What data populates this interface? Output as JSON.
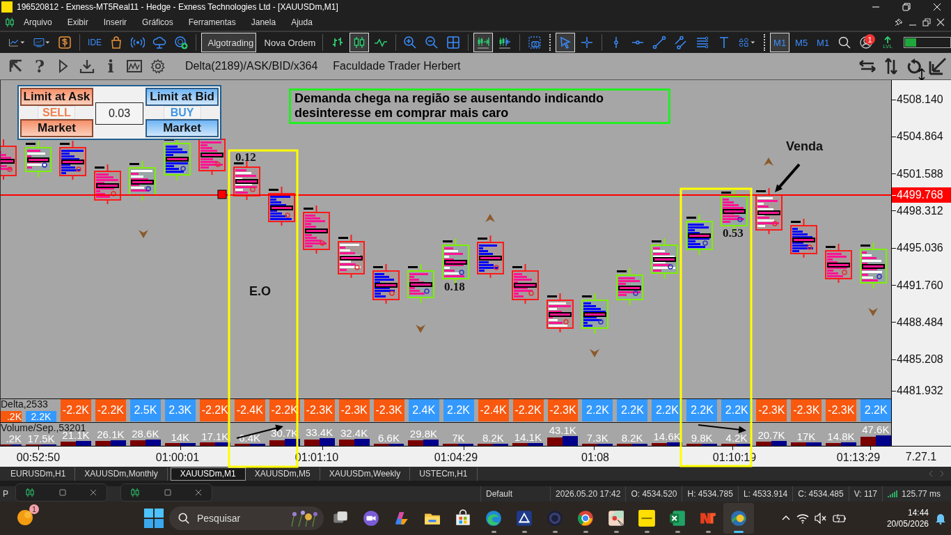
{
  "window": {
    "title": "196520812 - Exness-MT5Real11 - Hedge - Exness Technologies Ltd - [XAUUSDm,M1]"
  },
  "menu": [
    "Arquivo",
    "Exibir",
    "Inserir",
    "Gráficos",
    "Ferramentas",
    "Janela",
    "Ajuda"
  ],
  "toolbar": {
    "items": [
      {
        "kind": "icon",
        "selected": false
      },
      {
        "kind": "icon",
        "selected": false
      },
      {
        "kind": "icon",
        "selected": false
      },
      {
        "kind": "separator"
      },
      {
        "kind": "text",
        "label": "IDE",
        "selected": false
      },
      {
        "kind": "icon",
        "selected": false
      },
      {
        "kind": "icon",
        "selected": false
      },
      {
        "kind": "icon",
        "selected": false
      },
      {
        "kind": "icon",
        "selected": false
      },
      {
        "kind": "separator"
      },
      {
        "kind": "button",
        "label": "Algotrading",
        "selected": true
      },
      {
        "kind": "button",
        "label": "Nova Ordem",
        "selected": false
      },
      {
        "kind": "separator"
      },
      {
        "kind": "icon",
        "selected": false
      },
      {
        "kind": "icon",
        "selected": true
      },
      {
        "kind": "icon",
        "selected": false
      },
      {
        "kind": "separator"
      },
      {
        "kind": "icon",
        "selected": false
      },
      {
        "kind": "icon",
        "selected": false
      },
      {
        "kind": "icon",
        "selected": false
      },
      {
        "kind": "separator"
      },
      {
        "kind": "icon",
        "selected": true
      },
      {
        "kind": "icon",
        "selected": false
      },
      {
        "kind": "separator"
      },
      {
        "kind": "icon",
        "selected": false
      },
      {
        "kind": "dotted_separator"
      },
      {
        "kind": "icon",
        "selected": true
      },
      {
        "kind": "icon",
        "selected": false
      },
      {
        "kind": "separator"
      },
      {
        "kind": "icon",
        "selected": false
      },
      {
        "kind": "icon",
        "selected": false
      },
      {
        "kind": "icon",
        "selected": false
      },
      {
        "kind": "icon",
        "selected": false
      },
      {
        "kind": "icon",
        "selected": false
      },
      {
        "kind": "icon",
        "selected": false
      },
      {
        "kind": "icon",
        "selected": false
      },
      {
        "kind": "dotted_separator"
      },
      {
        "kind": "timeframe",
        "label": "M1",
        "selected": true
      },
      {
        "kind": "timeframe",
        "label": "M5",
        "selected": false
      },
      {
        "kind": "timeframe",
        "label": "M1",
        "selected": false
      },
      {
        "kind": "icon",
        "selected": false
      },
      {
        "kind": "account",
        "badge": "1"
      },
      {
        "kind": "lvl",
        "label": "LVL"
      },
      {
        "kind": "meter",
        "level": 0.25
      }
    ]
  },
  "chart_tools": [
    {
      "kind": "icon"
    },
    {
      "kind": "glyph",
      "text": "?"
    },
    {
      "kind": "icon"
    },
    {
      "kind": "icon"
    },
    {
      "kind": "glyph",
      "text": "i"
    },
    {
      "kind": "icon"
    },
    {
      "kind": "icon"
    }
  ],
  "indicator": "Delta(2189)/ASK/BID/x364",
  "author": "Faculdade Trader Herbert",
  "order_panel": {
    "sell_limit": "Limit at Ask",
    "sell": "SELL",
    "sell_market": "Market",
    "volume": "0.03",
    "buy_limit": "Limit at Bid",
    "buy": "BUY",
    "buy_market": "Market"
  },
  "note": "Demanda chega na região se ausentando indicando desinteresse em comprar mais caro",
  "labels": [
    {
      "kind": "value",
      "text": "0.12"
    },
    {
      "kind": "value",
      "text": "0.18"
    },
    {
      "kind": "value",
      "text": "0.53"
    },
    {
      "kind": "caption",
      "text": "E.O"
    },
    {
      "kind": "caption",
      "text": "Venda"
    }
  ],
  "footprint": {
    "candles": [
      {
        "kind": "bear"
      },
      {
        "kind": "bull"
      },
      {
        "kind": "bear"
      },
      {
        "kind": "bear"
      },
      {
        "kind": "bull"
      },
      {
        "kind": "bull"
      },
      {
        "kind": "bear"
      },
      {
        "kind": "bear"
      },
      {
        "kind": "bear"
      },
      {
        "kind": "bear"
      },
      {
        "kind": "bear"
      },
      {
        "kind": "bear"
      },
      {
        "kind": "bull"
      },
      {
        "kind": "bull"
      },
      {
        "kind": "bear"
      },
      {
        "kind": "bear"
      },
      {
        "kind": "bear"
      },
      {
        "kind": "bull"
      },
      {
        "kind": "bull"
      },
      {
        "kind": "bull"
      },
      {
        "kind": "bull"
      },
      {
        "kind": "bull"
      },
      {
        "kind": "bear"
      },
      {
        "kind": "bear"
      },
      {
        "kind": "bear"
      },
      {
        "kind": "bull"
      }
    ]
  },
  "price_axis": {
    "ticks": [
      "4508.140",
      "4504.864",
      "4501.588",
      "4498.312",
      "4495.036",
      "4491.760",
      "4488.484",
      "4485.208",
      "4481.932"
    ],
    "current": "4499.768"
  },
  "delta": {
    "title": "Delta,2533",
    "bars": [
      {
        "value": ".2K",
        "color": "#f9580f"
      },
      {
        "value": "2.2K",
        "color": "#3399ff"
      },
      {
        "value": "-2.2K",
        "color": "#f9580f"
      },
      {
        "value": "-2.2K",
        "color": "#f9580f"
      },
      {
        "value": "2.5K",
        "color": "#3399ff"
      },
      {
        "value": "2.3K",
        "color": "#3399ff"
      },
      {
        "value": "-2.2K",
        "color": "#f9580f"
      },
      {
        "value": "-2.4K",
        "color": "#f9580f"
      },
      {
        "value": "-2.2K",
        "color": "#f9580f"
      },
      {
        "value": "-2.3K",
        "color": "#f9580f"
      },
      {
        "value": "-2.3K",
        "color": "#f9580f"
      },
      {
        "value": "-2.3K",
        "color": "#f9580f"
      },
      {
        "value": "2.4K",
        "color": "#3399ff"
      },
      {
        "value": "2.2K",
        "color": "#3399ff"
      },
      {
        "value": "-2.4K",
        "color": "#f9580f"
      },
      {
        "value": "-2.2K",
        "color": "#f9580f"
      },
      {
        "value": "-2.3K",
        "color": "#f9580f"
      },
      {
        "value": "2.2K",
        "color": "#3399ff"
      },
      {
        "value": "2.2K",
        "color": "#3399ff"
      },
      {
        "value": "2.2K",
        "color": "#3399ff"
      },
      {
        "value": "2.2K",
        "color": "#3399ff"
      },
      {
        "value": "2.2K",
        "color": "#3399ff"
      },
      {
        "value": "-2.3K",
        "color": "#f9580f"
      },
      {
        "value": "-2.3K",
        "color": "#f9580f"
      },
      {
        "value": "-2.3K",
        "color": "#f9580f"
      },
      {
        "value": "2.2K",
        "color": "#3399ff"
      }
    ]
  },
  "volume": {
    "title": "Volume/Sep.,53201",
    "bars": [
      ".2K",
      "17.5K",
      "21.1K",
      "26.1K",
      "28.6K",
      "14K",
      "17.1K",
      "6.4K",
      "30.7K",
      "33.4K",
      "32.4K",
      "6.6K",
      "29.8K",
      "7K",
      "8.2K",
      "14.1K",
      "43.1K",
      "7.3K",
      "8.2K",
      "14.6K",
      "9.8K",
      "4.2K",
      "20.7K",
      "17K",
      "14.8K",
      "47.6K"
    ]
  },
  "time_axis": [
    "00:52:50",
    "01:00:01",
    "01:01:10",
    "01:04:29",
    "01:08",
    "01:10:19",
    "01:13:29"
  ],
  "version": "7.27.1",
  "tabs": [
    {
      "label": "EURUSDm,H1",
      "selected": false
    },
    {
      "label": "XAUUSDm,Monthly",
      "selected": false
    },
    {
      "label": "XAUUSDm,M1",
      "selected": true
    },
    {
      "label": "XAUUSDm,M5",
      "selected": false
    },
    {
      "label": "XAUUSDm,Weekly",
      "selected": false
    },
    {
      "label": "USTECm,H1",
      "selected": false
    }
  ],
  "minimized_windows": [
    {
      "kind": "chart"
    },
    {
      "kind": "chart"
    }
  ],
  "status_bar": {
    "left": "P",
    "profile": "Default",
    "datetime": "2026.05.20 17:42",
    "open": "O: 4534.520",
    "high": "H: 4534.785",
    "low": "L: 4533.914",
    "close": "C: 4534.485",
    "volume": "V: 117",
    "ping": "125.77 ms"
  },
  "taskbar": {
    "badge": "1",
    "search": "Pesquisar",
    "apps": [
      {
        "running": false,
        "selected": false
      },
      {
        "running": false,
        "selected": false
      },
      {
        "running": false,
        "selected": false
      },
      {
        "running": false,
        "selected": false
      },
      {
        "running": false,
        "selected": false
      },
      {
        "running": true,
        "selected": false
      },
      {
        "running": true,
        "selected": false
      },
      {
        "running": true,
        "selected": false
      },
      {
        "running": true,
        "selected": false
      },
      {
        "running": true,
        "selected": false
      },
      {
        "running": true,
        "selected": false
      },
      {
        "running": true,
        "selected": false
      },
      {
        "running": true,
        "selected": false
      },
      {
        "running": true,
        "selected": true
      }
    ],
    "time": "14:44",
    "date": "20/05/2026"
  }
}
